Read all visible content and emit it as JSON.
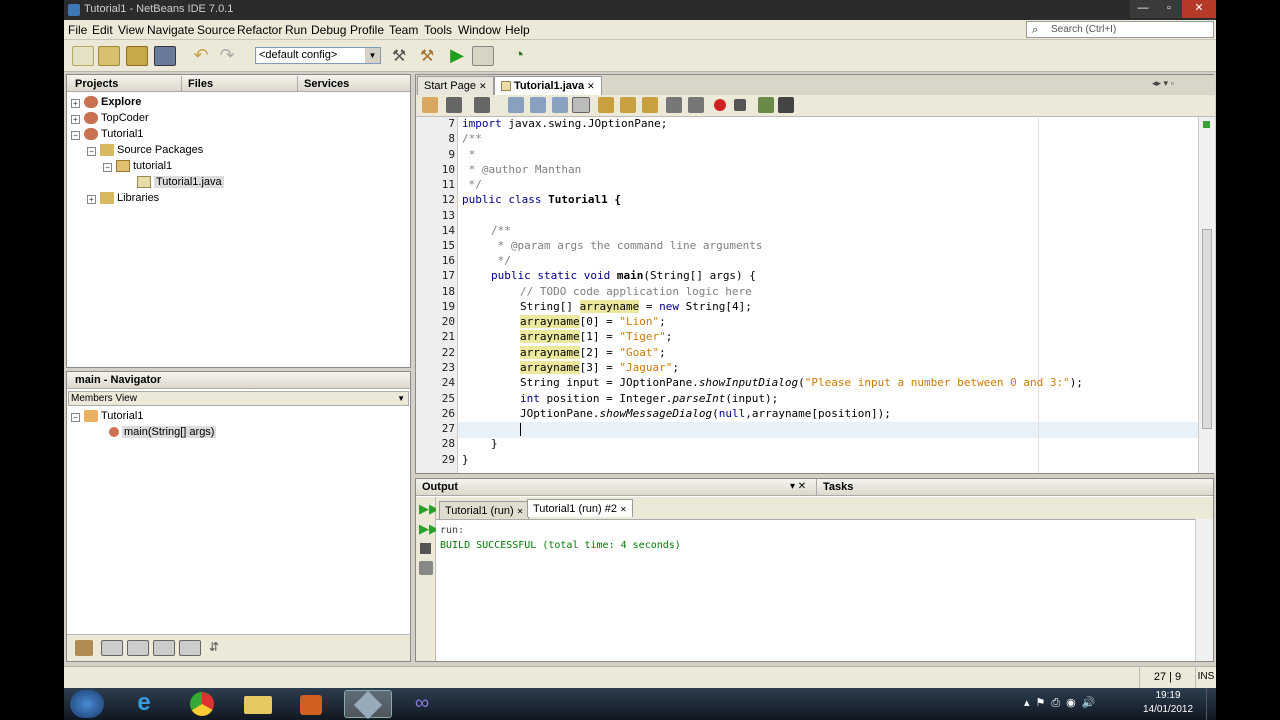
{
  "window": {
    "title": "Tutorial1 - NetBeans IDE 7.0.1",
    "min": "—",
    "max": "▫",
    "close": "✕"
  },
  "menu": [
    "File",
    "Edit",
    "View",
    "Navigate",
    "Source",
    "Refactor",
    "Run",
    "Debug",
    "Profile",
    "Team",
    "Tools",
    "Window",
    "Help"
  ],
  "search": {
    "placeholder": "Search (Ctrl+I)"
  },
  "toolbar": {
    "config": "<default config>"
  },
  "projects": {
    "tabs": [
      "Projects",
      "Files",
      "Services"
    ],
    "tree": [
      {
        "label": "Explore",
        "bold": true
      },
      {
        "label": "TopCoder"
      },
      {
        "label": "Tutorial1"
      },
      {
        "label": "Source Packages"
      },
      {
        "label": "tutorial1"
      },
      {
        "label": "Tutorial1.java"
      },
      {
        "label": "Libraries"
      }
    ]
  },
  "navigator": {
    "title": "main - Navigator",
    "view": "Members View",
    "items": [
      "Tutorial1",
      "main(String[] args)"
    ]
  },
  "editor": {
    "tabs": [
      "Start Page",
      "Tutorial1.java"
    ],
    "line_numbers": [
      "7",
      "8",
      "9",
      "10",
      "11",
      "12",
      "13",
      "14",
      "15",
      "16",
      "17",
      "18",
      "19",
      "20",
      "21",
      "22",
      "23",
      "24",
      "25",
      "26",
      "27",
      "28",
      "29"
    ],
    "code": {
      "l7_kw": "import",
      "l7": " javax.swing.JOptionPane;",
      "l8": "/**",
      "l9": " *",
      "l10": " * @author Manthan",
      "l11": " */",
      "l12_kw": "public class",
      "l12": " Tutorial1 {",
      "l14": "/**",
      "l15": " * @param args the command line arguments",
      "l16": " */",
      "l17_kw": "public static void",
      "l17_m": "main",
      "l17": "(String[] args) {",
      "l18": "// TODO code application logic here",
      "l19_a": "String[] ",
      "l19_h": "arrayname",
      "l19_b": " = ",
      "l19_kw": "new",
      "l19_c": " String[4];",
      "l20_h": "arrayname",
      "l20_a": "[0] = ",
      "l20_s": "\"Lion\"",
      "l20_b": ";",
      "l21_h": "arrayname",
      "l21_a": "[1] = ",
      "l21_s": "\"Tiger\"",
      "l21_b": ";",
      "l22_h": "arrayname",
      "l22_a": "[2] = ",
      "l22_s": "\"Goat\"",
      "l22_b": ";",
      "l23_h": "arrayname",
      "l23_a": "[3] = ",
      "l23_s": "\"Jaguar\"",
      "l23_b": ";",
      "l24_a": "String input = JOptionPane.",
      "l24_i": "showInputDialog",
      "l24_b": "(",
      "l24_s": "\"Please input a number between 0 and 3:\"",
      "l24_c": ");",
      "l25_kw": "int",
      "l25_a": " position = Integer.",
      "l25_i": "parseInt",
      "l25_b": "(input);",
      "l26_a": "JOptionPane.",
      "l26_i": "showMessageDialog",
      "l26_b": "(",
      "l26_kw": "null",
      "l26_c": ",arrayname[position]);",
      "l28": "}",
      "l29": "}"
    }
  },
  "output": {
    "title": "Output",
    "tasks": "Tasks",
    "tabs": [
      "Tutorial1 (run)",
      "Tutorial1 (run) #2"
    ],
    "lines": [
      "run:",
      "BUILD SUCCESSFUL (total time: 4 seconds)"
    ]
  },
  "status": {
    "position": "27 | 9",
    "mode": "INS"
  },
  "taskbar": {
    "time": "19:19",
    "date": "14/01/2012"
  },
  "colors": {
    "keyword": "#00008b",
    "string": "#ce7b00",
    "comment": "#7f7f7f",
    "highlight": "#ece99f",
    "success": "#007a00"
  }
}
